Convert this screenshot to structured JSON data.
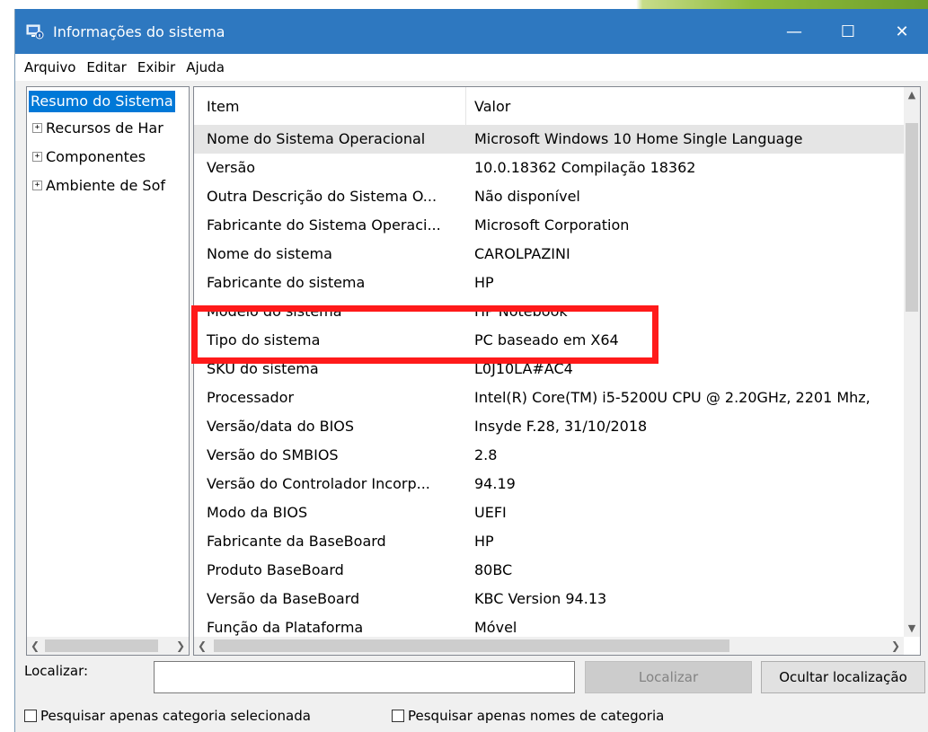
{
  "window": {
    "title": "Informações do sistema",
    "minimize_glyph": "—",
    "maximize_glyph": "☐",
    "close_glyph": "✕",
    "accent": "#2e78c0"
  },
  "menu": [
    "Arquivo",
    "Editar",
    "Exibir",
    "Ajuda"
  ],
  "tree": {
    "root": "Resumo do Sistema",
    "nodes": [
      "Recursos de Har",
      "Componentes",
      "Ambiente de Sof"
    ]
  },
  "list": {
    "columns": [
      "Item",
      "Valor"
    ],
    "rows": [
      {
        "item": "Nome do Sistema Operacional",
        "value": "Microsoft Windows 10 Home Single Language"
      },
      {
        "item": "Versão",
        "value": "10.0.18362 Compilação 18362"
      },
      {
        "item": "Outra Descrição do Sistema O...",
        "value": "Não disponível"
      },
      {
        "item": "Fabricante do Sistema Operaci...",
        "value": "Microsoft Corporation"
      },
      {
        "item": "Nome do sistema",
        "value": "CAROLPAZINI"
      },
      {
        "item": "Fabricante do sistema",
        "value": "HP"
      },
      {
        "item": "Modelo do sistema",
        "value": "HP Notebook"
      },
      {
        "item": "Tipo do sistema",
        "value": "PC baseado em X64"
      },
      {
        "item": "SKU do sistema",
        "value": "L0J10LA#AC4"
      },
      {
        "item": "Processador",
        "value": "Intel(R) Core(TM) i5-5200U CPU @ 2.20GHz, 2201 Mhz,"
      },
      {
        "item": "Versão/data do BIOS",
        "value": "Insyde F.28, 31/10/2018"
      },
      {
        "item": "Versão do SMBIOS",
        "value": "2.8"
      },
      {
        "item": "Versão do Controlador Incorp...",
        "value": "94.19"
      },
      {
        "item": "Modo da BIOS",
        "value": "UEFI"
      },
      {
        "item": "Fabricante da BaseBoard",
        "value": "HP"
      },
      {
        "item": "Produto BaseBoard",
        "value": "80BC"
      },
      {
        "item": "Versão da BaseBoard",
        "value": "KBC Version 94.13"
      },
      {
        "item": "Função da Plataforma",
        "value": "Móvel"
      }
    ]
  },
  "find": {
    "label": "Localizar:",
    "value": "",
    "find_button": "Localizar",
    "hide_button": "Ocultar localização",
    "checkbox_selected_category": "Pesquisar apenas categoria selecionada",
    "checkbox_category_names": "Pesquisar apenas nomes de categoria"
  },
  "highlight_color": "#ff1a1a"
}
